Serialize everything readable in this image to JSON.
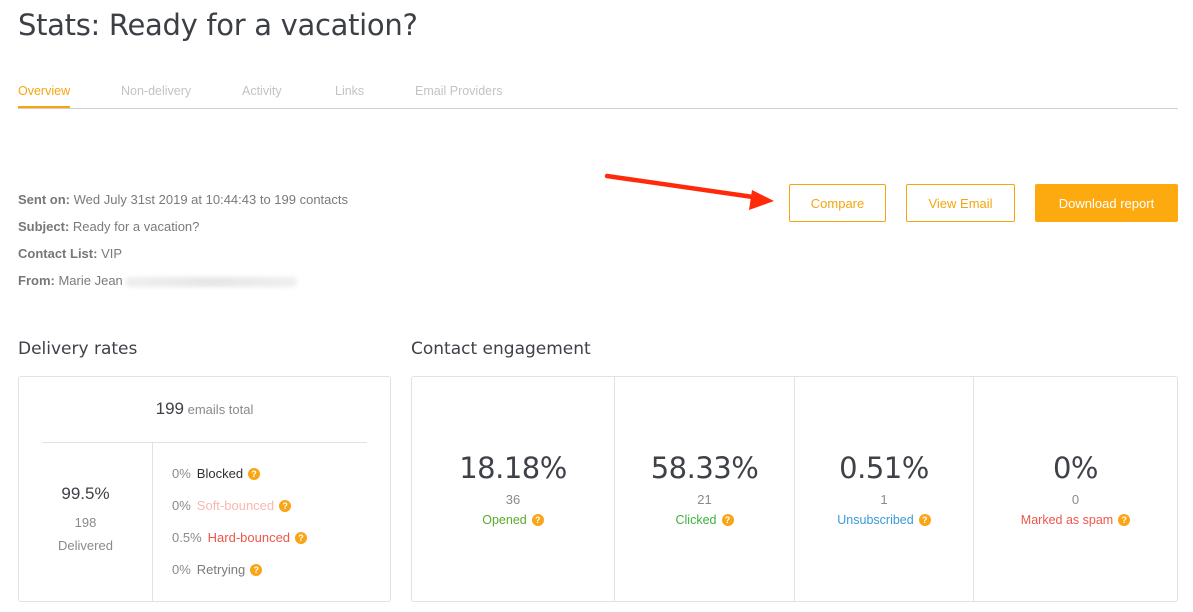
{
  "page": {
    "title": "Stats: Ready for a vacation?"
  },
  "tabs": [
    {
      "label": "Overview",
      "active": true
    },
    {
      "label": "Non-delivery",
      "active": false
    },
    {
      "label": "Activity",
      "active": false
    },
    {
      "label": "Links",
      "active": false
    },
    {
      "label": "Email Providers",
      "active": false
    }
  ],
  "meta": {
    "sent_on_label": "Sent on:",
    "sent_on_value": "Wed July 31st 2019 at 10:44:43 to 199 contacts",
    "subject_label": "Subject:",
    "subject_value": "Ready for a vacation?",
    "list_label": "Contact List:",
    "list_value": "VIP",
    "from_label": "From:",
    "from_value": "Marie Jean"
  },
  "actions": {
    "compare": "Compare",
    "view_email": "View Email",
    "download": "Download report"
  },
  "delivery": {
    "title": "Delivery rates",
    "total_count": "199",
    "total_label": "emails total",
    "delivered_pct": "99.5%",
    "delivered_count": "198",
    "delivered_label": "Delivered",
    "breakdown": [
      {
        "pct": "0%",
        "label": "Blocked",
        "color": "#2f3136"
      },
      {
        "pct": "0%",
        "label": "Soft-bounced",
        "color": "#f9b8b0"
      },
      {
        "pct": "0.5%",
        "label": "Hard-bounced",
        "color": "#f0564a"
      },
      {
        "pct": "0%",
        "label": "Retrying",
        "color": "#7a7a7a"
      }
    ]
  },
  "engagement": {
    "title": "Contact engagement",
    "metrics": [
      {
        "pct": "18.18%",
        "count": "36",
        "label": "Opened",
        "color": "#5aaa2e"
      },
      {
        "pct": "58.33%",
        "count": "21",
        "label": "Clicked",
        "color": "#3db23d"
      },
      {
        "pct": "0.51%",
        "count": "1",
        "label": "Unsubscribed",
        "color": "#3a9ad9"
      },
      {
        "pct": "0%",
        "count": "0",
        "label": "Marked as spam",
        "color": "#f0564a"
      }
    ]
  },
  "help_glyph": "?",
  "colors": {
    "accent": "#f5a50e",
    "annotation_arrow": "#ff2a0a"
  }
}
